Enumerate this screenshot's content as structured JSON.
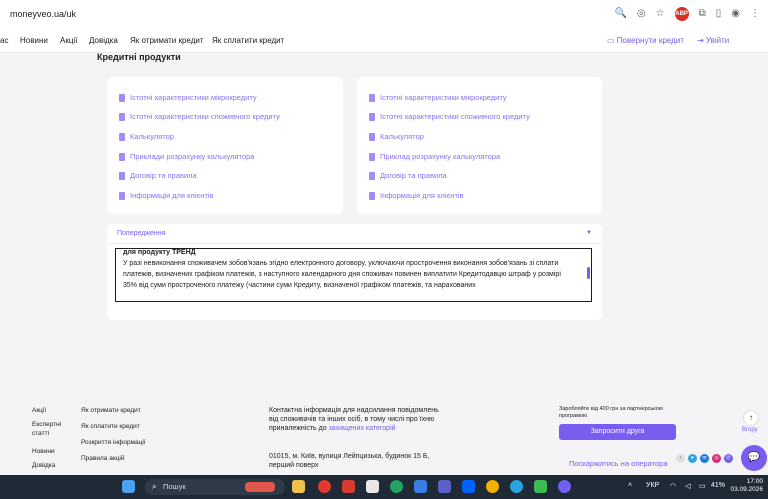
{
  "browser": {
    "url": "moneyveo.ua/uk"
  },
  "nav": {
    "items": [
      "ас",
      "Новини",
      "Акції",
      "Довідка",
      "Як отримати кредит",
      "Як сплатити кредит"
    ],
    "return_credit": "Повернути кредит",
    "login": "Увійти"
  },
  "section_title": "Кредитні продукти",
  "card_left": {
    "links": [
      "Істотні характеристики мікрокредиту",
      "Істотні характеристики споживчого кредиту",
      "Калькулятор",
      "Приклади розрахунку калькулятора",
      "Договір та правила",
      "Інформація для клієнтів"
    ]
  },
  "card_right": {
    "links": [
      "Істотні характеристики мікрокредиту",
      "Істотні характеристики споживчого кредиту",
      "Калькулятор",
      "Приклад розрахунку калькулятора",
      "Договір та правила",
      "Інформація для клієнтів"
    ]
  },
  "warning": {
    "title": "Попередження",
    "cut_line": "для продукту ТРЕНД",
    "text": "У разі невиконання споживачем зобов'язань згідно електронного договору, уключаючи прострочення виконання зобов'язань зі сплати платежів, визначених графіком платежів, з наступного календарного дня споживач повинен виплатити Кредитодавцю штраф у розмірі 35% від суми простроченого платежу (частини суми Кредиту, визначеної графіком платежів, та нарахованих"
  },
  "footer": {
    "col1": [
      "Акції",
      "Експертні статті",
      "Новини",
      "Довідка"
    ],
    "col2": [
      "Як отримати кредит",
      "Як сплатити кредит",
      "Розкриття інформації",
      "Правила акцій"
    ],
    "contact_text": "Контактна інформація для надсилання повідомлень від споживачів та інших осіб, в тому числі про їхню приналежність до",
    "contact_link": "захищених категорій",
    "address": "01015, м. Київ, вулиця Лейпцизька, будинок 15 Б, перший поверх",
    "promo": "Заробляйте від 400 грн за партнерською програмою",
    "invite_button": "Запросити друга",
    "complain": "Поскаржитись на оператора",
    "up_label": "Вгору"
  },
  "taskbar": {
    "search": "Пошук",
    "lang": "УКР",
    "battery": "41%",
    "time": "17:00",
    "date": "03.09.2026"
  },
  "colors": {
    "accent": "#7b5cf0",
    "link": "#8b6ff5",
    "taskbar": "#1f2a36"
  }
}
